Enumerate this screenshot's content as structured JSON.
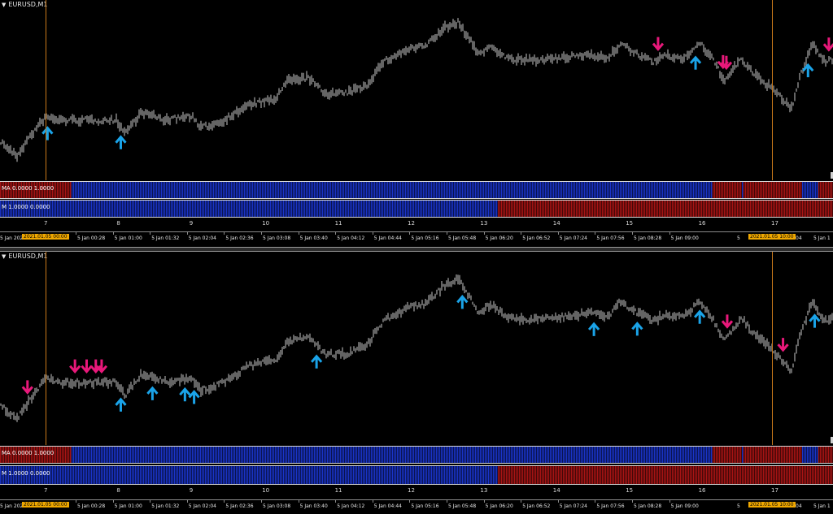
{
  "symbol": "EURUSD,M1",
  "colors": {
    "bg": "#000000",
    "price": "#c8c8c8",
    "up_arrow": "#1aa3e8",
    "down_arrow": "#e8187a",
    "blue_bar": "#1a34c8",
    "red_bar": "#a81414",
    "vline": "#c8781a"
  },
  "indicators": {
    "ma_label": "MA 0.0000 1.0000",
    "m_label": "M 1.0000 0.0000"
  },
  "hour_axis": [
    "7",
    "8",
    "9",
    "10",
    "11",
    "12",
    "13",
    "14",
    "15",
    "16",
    "17"
  ],
  "time_axis": {
    "first_label": "5 Jan 2021",
    "labels": [
      "5 Jan 00:28",
      "5 Jan 01:00",
      "5 Jan 01:32",
      "5 Jan 02:04",
      "5 Jan 02:36",
      "5 Jan 03:08",
      "5 Jan 03:40",
      "5 Jan 04:12",
      "5 Jan 04:44",
      "5 Jan 05:16",
      "5 Jan 05:48",
      "5 Jan 06:20",
      "5 Jan 06:52",
      "5 Jan 07:24",
      "5 Jan 07:56",
      "5 Jan 08:28",
      "5 Jan 09:00"
    ],
    "highlight_left": "2021.01.05 00:00",
    "highlight_right": "2021.01.05 10:00",
    "tail_mid": "5",
    "tail_right_1": ":04",
    "tail_right_2": "5 Jan 1"
  },
  "panels": [
    {
      "name": "top",
      "up_arrows": [
        0.057,
        0.145,
        0.835,
        0.97
      ],
      "down_arrows": [
        0.79,
        0.868,
        0.872,
        0.995
      ]
    },
    {
      "name": "bottom",
      "up_arrows": [
        0.145,
        0.183,
        0.222,
        0.233,
        0.38,
        0.555,
        0.713,
        0.765,
        0.84,
        0.978
      ],
      "down_arrows": [
        0.033,
        0.09,
        0.104,
        0.115,
        0.122,
        0.873,
        0.94
      ]
    }
  ]
}
